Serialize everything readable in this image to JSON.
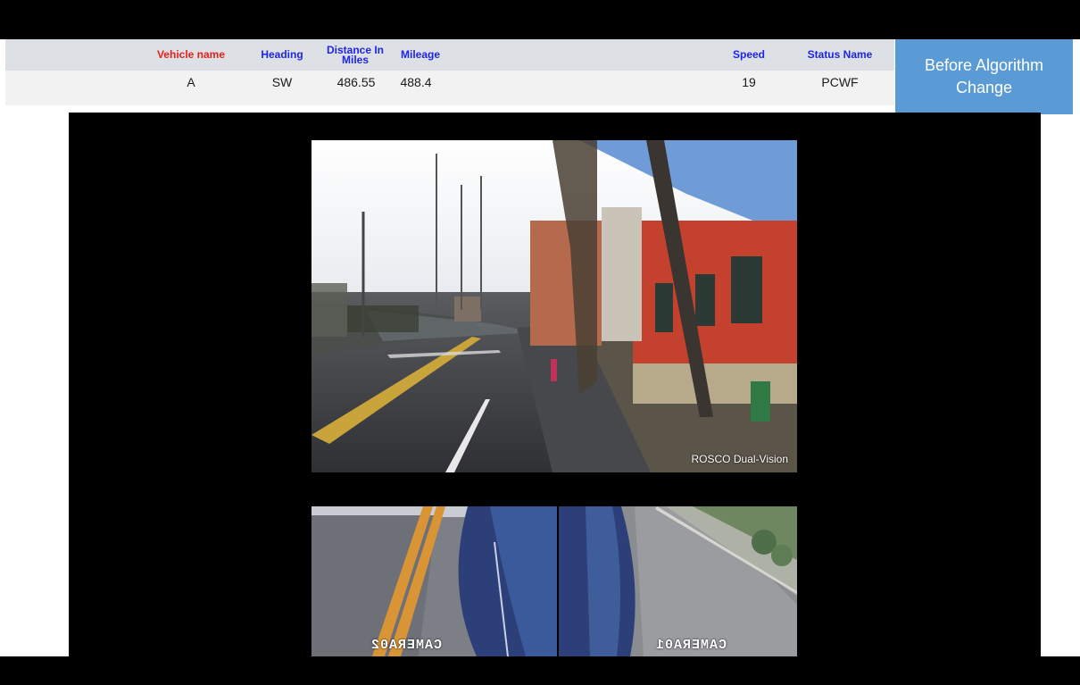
{
  "table": {
    "headers": {
      "vehicle_name": "Vehicle name",
      "heading": "Heading",
      "distance_line1": "Distance In",
      "distance_line2": "Miles",
      "mileage": "Mileage",
      "speed": "Speed",
      "status_name": "Status Name"
    },
    "values": {
      "vehicle_name": "A",
      "heading": "SW",
      "distance": "486.55",
      "mileage": "488.4",
      "speed": "19",
      "status_name": "PCWF"
    }
  },
  "side_button": {
    "line1": "Before Algorithm",
    "line2": "Change"
  },
  "cameras": {
    "main_label": "ROSCO Dual-Vision",
    "left_tag": "CAMERA02",
    "right_tag": "CAMERA01"
  },
  "colors": {
    "header_red": "#e8201c",
    "header_blue": "#1f25e6",
    "button_blue": "#5b9bd5"
  }
}
